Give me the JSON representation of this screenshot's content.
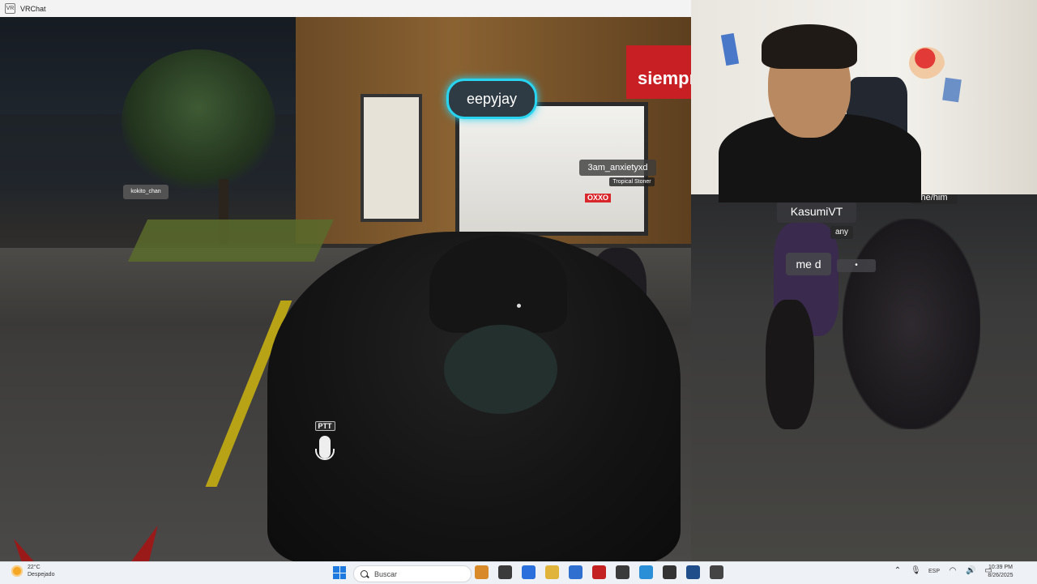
{
  "window": {
    "title": "VRChat",
    "icon_text": "VR"
  },
  "game": {
    "store_sign_text": "siempr",
    "oxxo_sign": "OXXO",
    "nameplates": {
      "eepyjay": "eepyjay",
      "anxiety": "3am_anxietyxd",
      "anxiety_sub": "Tropical Stoner",
      "kokito": "kokito_chan",
      "kasumi": "KasumiVT",
      "any": "any",
      "hehim": "he/him",
      "med": "me d",
      "dot": "•"
    },
    "ptt_label": "PTT"
  },
  "taskbar": {
    "weather_temp": "22°C",
    "weather_desc": "Despejado",
    "search_placeholder": "Buscar",
    "language": "ESP",
    "time": "10:39 PM",
    "date": "8/26/2025",
    "app_colors": [
      "#d88a2b",
      "#3b3b3b",
      "#2a6fdb",
      "#e0b43a",
      "#2f6fd0",
      "#c42222",
      "#3a3a3a",
      "#2a8fd6",
      "#333333",
      "#1f4e8a",
      "#444444"
    ]
  }
}
